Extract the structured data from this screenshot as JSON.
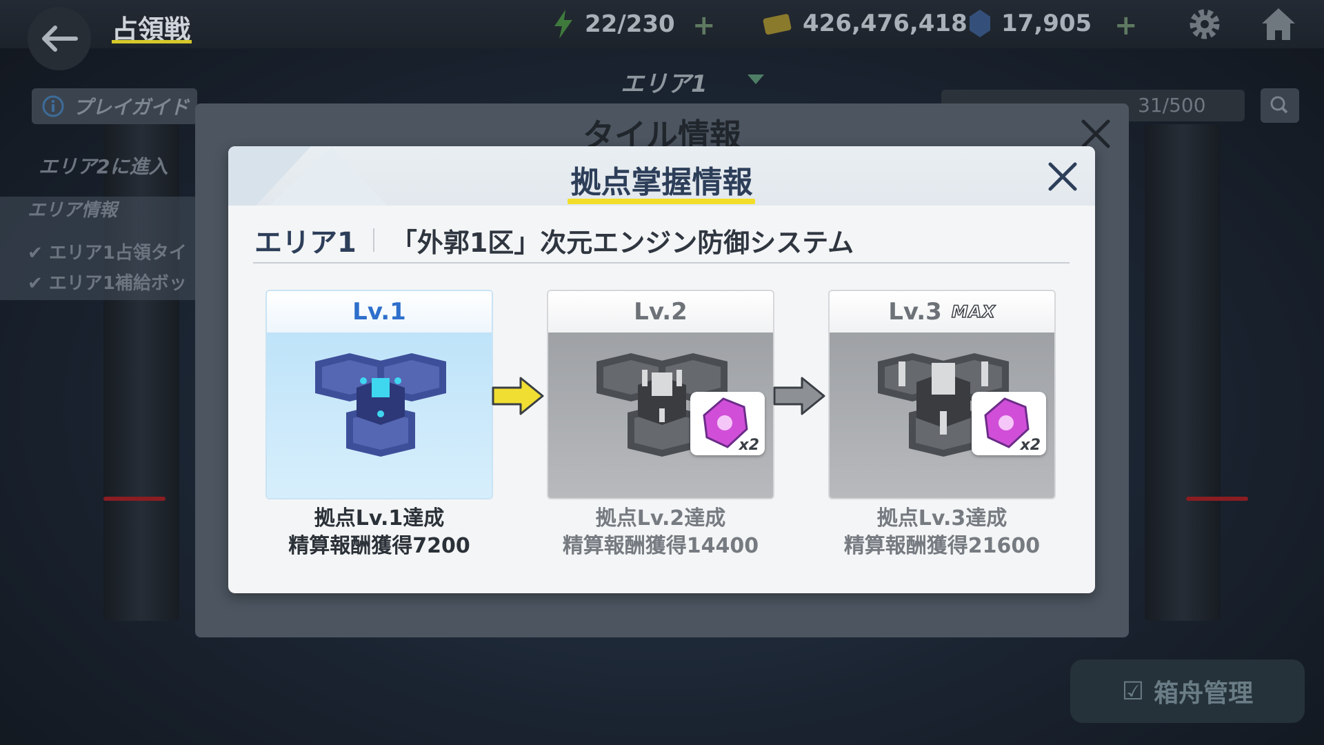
{
  "topbar": {
    "title": "占領戦",
    "stamina": "22/230",
    "coins": "426,476,418",
    "gems": "17,905",
    "icons": [
      "back-icon",
      "lightning-icon",
      "coin-icon",
      "crystal-icon",
      "gear-icon",
      "home-icon"
    ]
  },
  "background": {
    "area_select": "エリア1",
    "play_guide": "プレイガイド",
    "progress": "31/500",
    "area_enter": "エリア2に進入",
    "area_info_heading": "エリア情報",
    "checks": [
      "エリア1占領タイ",
      "エリア1補給ボッ"
    ],
    "ark_button": "箱舟管理"
  },
  "outer_dialog": {
    "title": "タイル情報"
  },
  "modal": {
    "title": "拠点掌握情報",
    "area_label": "エリア1",
    "area_description": "「外郭1区」次元エンジン防御システム",
    "levels": [
      {
        "label": "Lv.1",
        "line1": "拠点Lv.1達成",
        "line2": "精算報酬獲得7200",
        "state": "active",
        "reward": null
      },
      {
        "label": "Lv.2",
        "line1": "拠点Lv.2達成",
        "line2": "精算報酬獲得14400",
        "state": "locked",
        "reward": "x2"
      },
      {
        "label": "Lv.3",
        "max_badge": "MAX",
        "line1": "拠点Lv.3達成",
        "line2": "精算報酬獲得21600",
        "state": "locked",
        "reward": "x2"
      }
    ]
  },
  "colors": {
    "accent_yellow": "#f2de2a",
    "title_navy": "#2d3e59",
    "active_blue": "#2e6fcb",
    "reward_pink": "#d14fd8"
  }
}
